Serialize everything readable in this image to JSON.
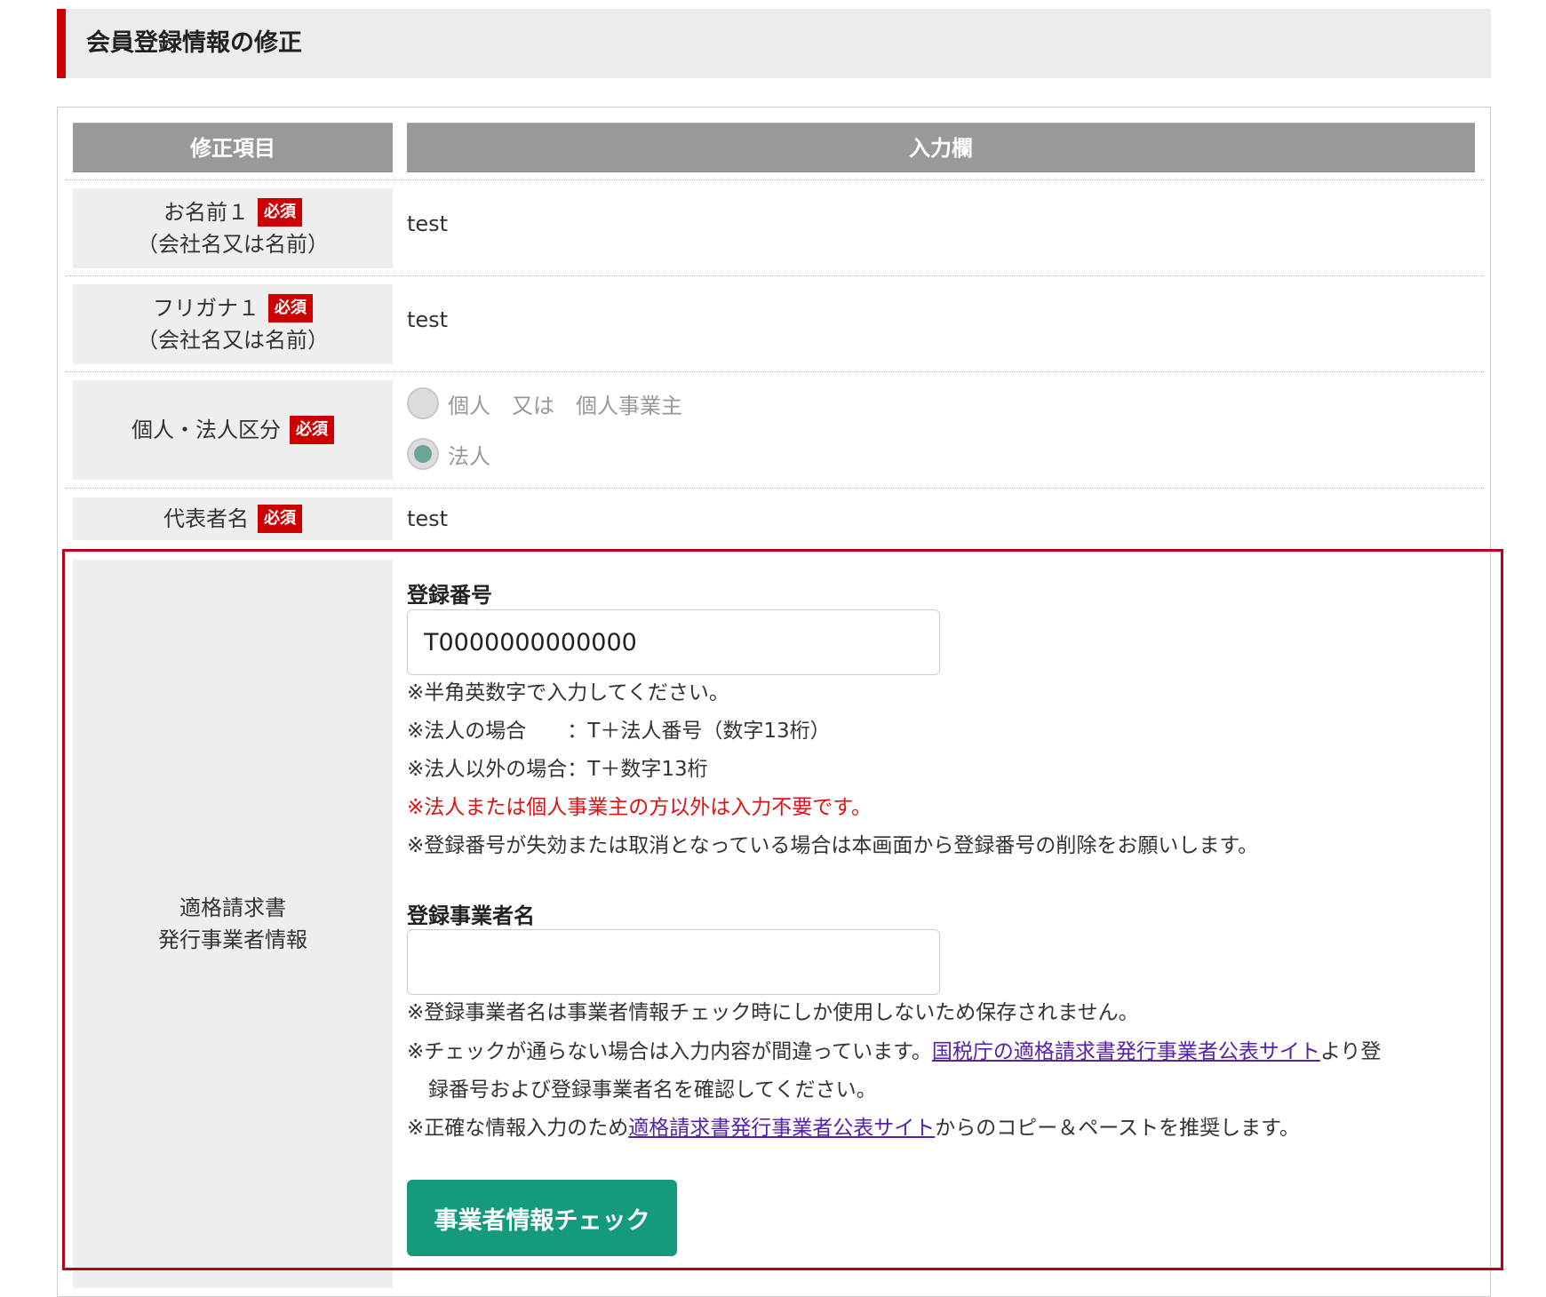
{
  "page_title": "会員登録情報の修正",
  "table_header": {
    "item": "修正項目",
    "input": "入力欄"
  },
  "required_badge": "必須",
  "rows": {
    "name1": {
      "label_line1": "お名前１",
      "label_line2": "（会社名又は名前）",
      "value": "test"
    },
    "furigana1": {
      "label_line1": "フリガナ１",
      "label_line2": "（会社名又は名前）",
      "value": "test"
    },
    "entity_type": {
      "label": "個人・法人区分",
      "options": [
        {
          "label": "個人　又は　個人事業主",
          "selected": false
        },
        {
          "label": "法人",
          "selected": true
        }
      ]
    },
    "representative": {
      "label": "代表者名",
      "value": "test"
    },
    "invoice": {
      "label_line1": "適格請求書",
      "label_line2": "発行事業者情報",
      "reg_number_label": "登録番号",
      "reg_number_value": "T0000000000000",
      "reg_number_notes": [
        "※半角英数字で入力してください。",
        "※法人の場合　　：T＋法人番号（数字13桁）",
        "※法人以外の場合：T＋数字13桁",
        "※法人または個人事業主の方以外は入力不要です。",
        "※登録番号が失効または取消となっている場合は本画面から登録番号の削除をお願いします。"
      ],
      "business_name_label": "登録事業者名",
      "business_name_value": "",
      "business_name_note1": "※登録事業者名は事業者情報チェック時にしか使用しないため保存されません。",
      "business_name_note2_pre": "※チェックが通らない場合は入力内容が間違っています。",
      "business_name_note2_link": "国税庁の適格請求書発行事業者公表サイト",
      "business_name_note2_post": "より登",
      "business_name_note2_cont": "録番号および登録事業者名を確認してください。",
      "business_name_note3_pre": "※正確な情報入力のため",
      "business_name_note3_link": "適格請求書発行事業者公表サイト",
      "business_name_note3_post": "からのコピー＆ペーストを推奨します。",
      "check_button": "事業者情報チェック"
    }
  },
  "colors": {
    "accent_red": "#cc0000",
    "highlight_border": "#b8001c",
    "header_gray": "#999999",
    "button_green": "#169a7e",
    "link": "#5522aa",
    "warning_text": "#dd1111"
  }
}
